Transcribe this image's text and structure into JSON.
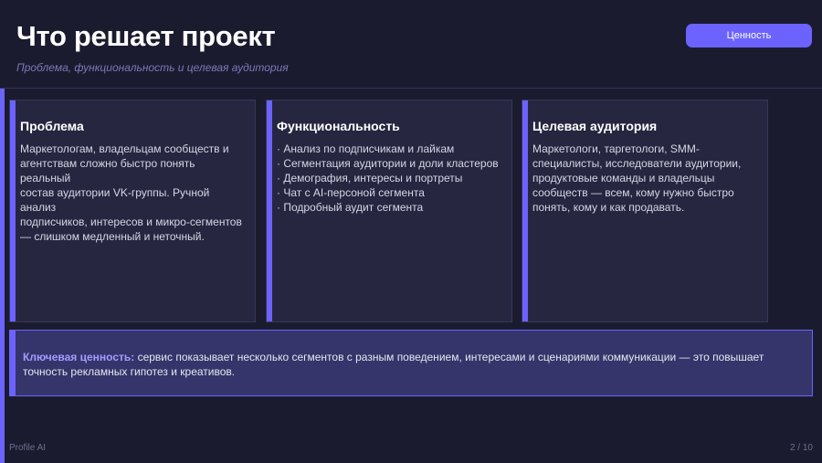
{
  "header": {
    "title": "Что решает проект",
    "subtitle": "Проблема, функциональность и целевая аудитория",
    "tag_label": "Ценность"
  },
  "cards": [
    {
      "title": "Проблема",
      "lines": [
        "Маркетологам, владельцам сообществ и",
        "агентствам сложно быстро понять реальный",
        "состав аудитории VK-группы. Ручной анализ",
        "подписчиков, интересов и микро-сегментов",
        "— слишком медленный и неточный."
      ]
    },
    {
      "title": "Функциональность",
      "items": [
        "Анализ по подписчикам и лайкам",
        "Сегментация аудитории и доли кластеров",
        "Демография, интересы и портреты",
        "Чат с AI-персоной сегмента",
        "Подробный аудит сегмента"
      ]
    },
    {
      "title": "Целевая аудитория",
      "lines": [
        "Маркетологи, таргетологи, SMM-",
        "специалисты, исследователи аудитории,",
        "продуктовые команды и владельцы",
        "сообществ — всем, кому нужно быстро",
        "понять, кому и как продавать."
      ]
    }
  ],
  "value": {
    "label": "Ключевая ценность:",
    "text": " сервис показывает несколько сегментов с разным поведением, интересами и сценариями коммуникации — это повышает точность рекламных гипотез и креативов."
  },
  "footer": {
    "brand": "Profile AI",
    "page": "2 / 10"
  },
  "colors": {
    "accent": "#6c63ff",
    "background": "#1b1b2f",
    "card": "#262641"
  }
}
